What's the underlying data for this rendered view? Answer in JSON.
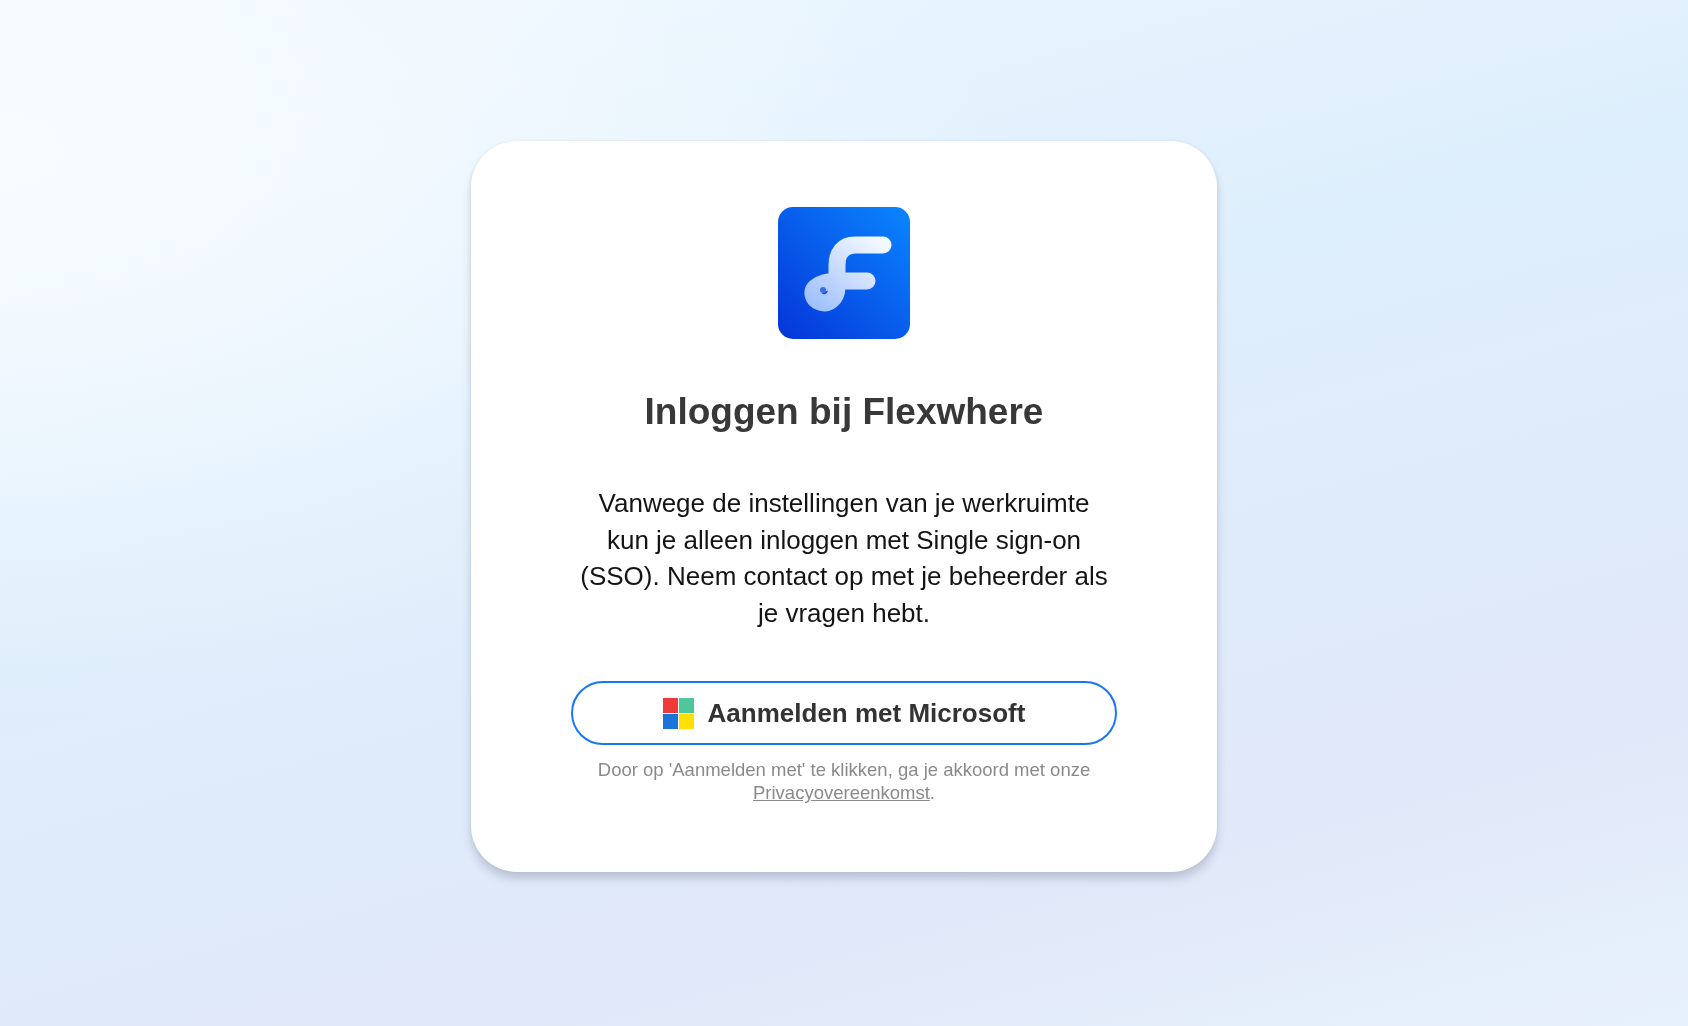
{
  "title": "Inloggen bij Flexwhere",
  "message": "Vanwege de instellingen van je werkruimte kun je alleen inloggen met Single sign-on (SSO). Neem contact op met je beheerder als je vragen hebt.",
  "sso_button": {
    "label": "Aanmelden met Microsoft"
  },
  "consent": {
    "text": "Door op 'Aanmelden met' te klikken, ga je akkoord met onze",
    "link": "Privacyovereenkomst",
    "end": "."
  }
}
